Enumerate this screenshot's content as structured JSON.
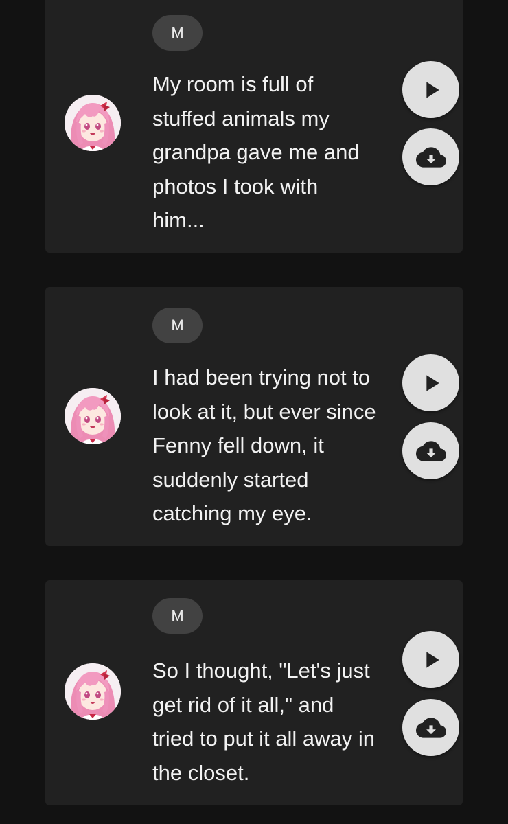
{
  "messages": [
    {
      "speaker_initial": "M",
      "avatar_icon": "anime-girl-pink-hair-avatar",
      "text": "My room is full of stuffed animals my grandpa gave me and photos I took with him...",
      "lines": [
        "My room is full of",
        "stuffed animals my",
        "grandpa gave me and",
        "photos I took with",
        "him..."
      ]
    },
    {
      "speaker_initial": "M",
      "avatar_icon": "anime-girl-pink-hair-avatar",
      "text": "I had been trying not to look at it, but ever since Fenny fell down, it suddenly started catching my eye.",
      "lines": [
        "I had been trying not to",
        "look at it, but ever since",
        "Fenny fell down, it",
        "suddenly started",
        "catching my eye."
      ]
    },
    {
      "speaker_initial": "M",
      "avatar_icon": "anime-girl-pink-hair-avatar",
      "text": "So I thought, \"Let's just get rid of it all,\" and tried to put it all away in the closet.",
      "lines": [
        "So I thought, \"Let's just",
        "get rid of it all,\" and",
        "tried to put it all away in",
        "the closet."
      ]
    }
  ],
  "icons": {
    "play": "play-icon",
    "download": "cloud-download-icon"
  },
  "colors": {
    "background": "#121212",
    "card": "#212121",
    "badge": "#424242",
    "button": "#e0e0e0",
    "icon": "#212121",
    "text": "#f2f2f2",
    "avatar_hair": "#f08fb8"
  }
}
